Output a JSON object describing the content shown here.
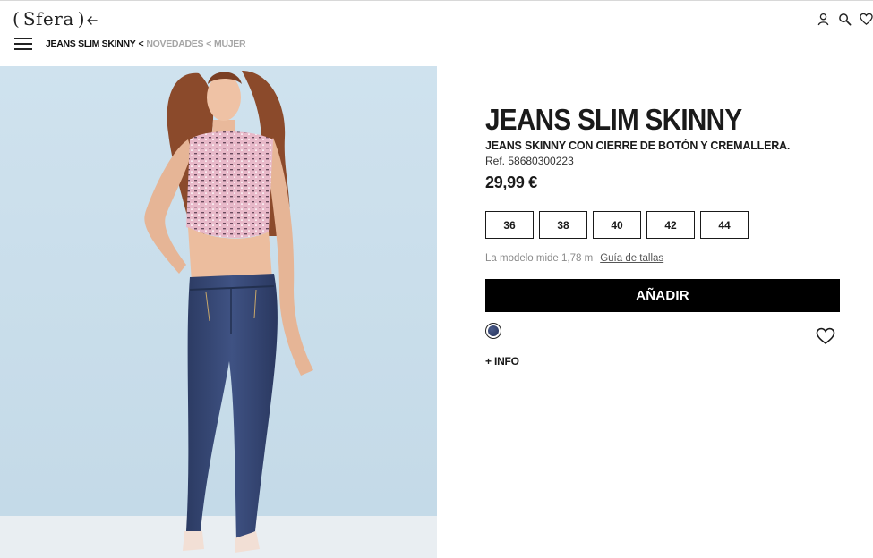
{
  "header": {
    "logo": {
      "open": "(",
      "word": "Sfera",
      "close": ")"
    },
    "breadcrumb": {
      "current": "JEANS SLIM SKINNY",
      "sep1": "<",
      "link1": "NOVEDADES",
      "sep2": "<",
      "link2": "MUJER"
    },
    "icons": [
      "user-icon",
      "search-icon",
      "heart-icon"
    ]
  },
  "product": {
    "title": "JEANS SLIM SKINNY",
    "subtitle": "JEANS SKINNY CON CIERRE DE BOTÓN Y CREMALLERA.",
    "ref": "Ref. 58680300223",
    "price": "29,99 €",
    "sizes": [
      "36",
      "38",
      "40",
      "42",
      "44"
    ],
    "model_note": "La modelo mide 1,78 m",
    "size_guide": "Guía de tallas",
    "add_button": "AÑADIR",
    "color_swatch": "#2e3a5e",
    "more_info": "+ INFO"
  },
  "colors": {
    "accent": "#000000",
    "breadcrumb_muted": "#a5a5a5",
    "image_background": "#c9dde9"
  }
}
